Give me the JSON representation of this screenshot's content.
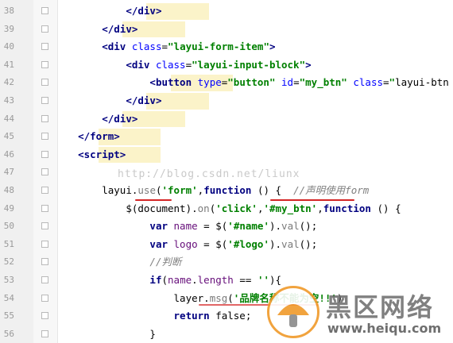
{
  "colors": {
    "tag": "#000080",
    "attr": "#0000ff",
    "string": "#008000",
    "keyword": "#000080",
    "method": "#7a7a7a",
    "comment": "#808080",
    "plain": "#000000",
    "variable": "#660e7a",
    "gutter_bg": "#f0f0f0",
    "highlight": "#fbf3c9",
    "underline": "#d42525"
  },
  "editor": {
    "watermark": "http://blog.csdn.net/liunx",
    "lines": [
      {
        "num": "38",
        "text": "            </div>"
      },
      {
        "num": "39",
        "text": "        </div>"
      },
      {
        "num": "40",
        "text": "        <div class=\"layui-form-item\">"
      },
      {
        "num": "41",
        "text": "            <div class=\"layui-input-block\">"
      },
      {
        "num": "42",
        "text": "                <button type=\"button\" id=\"my_btn\" class=\"layui-btn"
      },
      {
        "num": "43",
        "text": "            </div>"
      },
      {
        "num": "44",
        "text": "        </div>"
      },
      {
        "num": "45",
        "text": "    </form>"
      },
      {
        "num": "46",
        "text": "    <script>"
      },
      {
        "num": "47",
        "text": ""
      },
      {
        "num": "48",
        "text": "        layui.use('form',function () {  //声明使用form"
      },
      {
        "num": "49",
        "text": "            $(document).on('click','#my_btn',function () {"
      },
      {
        "num": "50",
        "text": "                var name = $('#name').val();"
      },
      {
        "num": "51",
        "text": "                var logo = $('#logo').val();"
      },
      {
        "num": "52",
        "text": "                //判断"
      },
      {
        "num": "53",
        "text": "                if(name.length == ''){"
      },
      {
        "num": "54",
        "text": "                    layer.msg('品牌名称不能为空!!')"
      },
      {
        "num": "55",
        "text": "                    return false;"
      },
      {
        "num": "56",
        "text": "                }"
      }
    ]
  },
  "logo": {
    "cn": "黑区网络",
    "url": "www.heiqu.com"
  }
}
